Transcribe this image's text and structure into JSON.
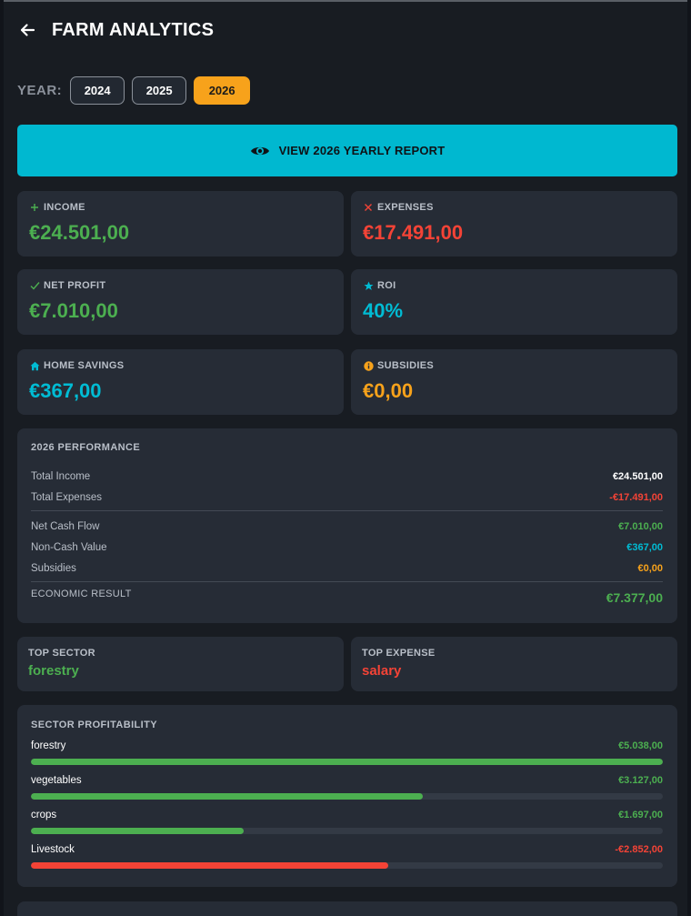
{
  "header": {
    "title": "FARM ANALYTICS",
    "back_icon": "arrow-left-icon"
  },
  "year_selector": {
    "label": "YEAR:",
    "years": [
      "2024",
      "2025",
      "2026"
    ],
    "selected": "2026"
  },
  "report_button": {
    "label": "VIEW 2026 YEARLY REPORT",
    "icon": "eye-icon"
  },
  "stats": {
    "income": {
      "label": "INCOME",
      "value": "€24.501,00",
      "icon": "plus-icon",
      "color": "#4caf50"
    },
    "expenses": {
      "label": "EXPENSES",
      "value": "€17.491,00",
      "icon": "close-icon",
      "color": "#f44336"
    },
    "net_profit": {
      "label": "NET PROFIT",
      "value": "€7.010,00",
      "icon": "check-icon",
      "color": "#4caf50"
    },
    "roi": {
      "label": "ROI",
      "value": "40%",
      "icon": "star-icon",
      "color": "#00bcd4"
    },
    "home_savings": {
      "label": "HOME SAVINGS",
      "value": "€367,00",
      "icon": "home-icon",
      "color": "#00bcd4"
    },
    "subsidies": {
      "label": "SUBSIDIES",
      "value": "€0,00",
      "icon": "info-icon",
      "color": "#f7a21b"
    }
  },
  "performance": {
    "title": "2026 PERFORMANCE",
    "total_income": {
      "label": "Total Income",
      "value": "€24.501,00"
    },
    "total_expenses": {
      "label": "Total Expenses",
      "value": "-€17.491,00"
    },
    "net_cash_flow": {
      "label": "Net Cash Flow",
      "value": "€7.010,00"
    },
    "non_cash_value": {
      "label": "Non-Cash Value",
      "value": "€367,00"
    },
    "subsidies": {
      "label": "Subsidies",
      "value": "€0,00"
    },
    "economic_result": {
      "label": "ECONOMIC RESULT",
      "value": "€7.377,00"
    }
  },
  "top": {
    "sector": {
      "label": "TOP SECTOR",
      "value": "forestry"
    },
    "expense": {
      "label": "TOP EXPENSE",
      "value": "salary"
    }
  },
  "sector_profitability": {
    "title": "SECTOR PROFITABILITY",
    "sectors": [
      {
        "name": "forestry",
        "amount": "€5.038,00",
        "fraction": 1.0,
        "color": "#4caf50"
      },
      {
        "name": "vegetables",
        "amount": "€3.127,00",
        "fraction": 0.62,
        "color": "#4caf50"
      },
      {
        "name": "crops",
        "amount": "€1.697,00",
        "fraction": 0.337,
        "color": "#4caf50"
      },
      {
        "name": "Livestock",
        "amount": "-€2.852,00",
        "fraction": 0.566,
        "color": "#f44336"
      }
    ]
  }
}
